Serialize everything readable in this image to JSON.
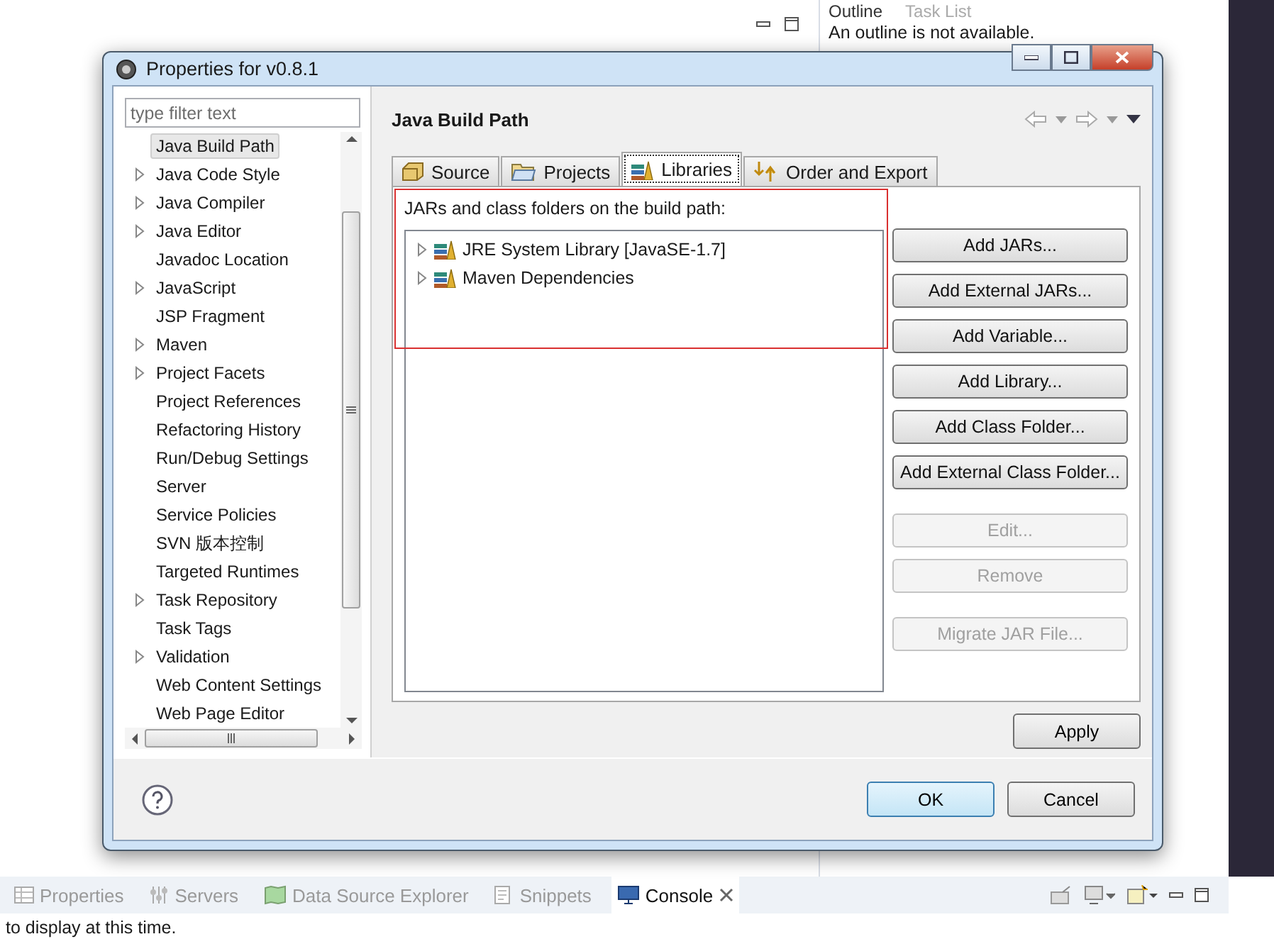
{
  "ide": {
    "top_tabs": [
      {
        "label": "Outline",
        "selected": true
      },
      {
        "label": "Task List",
        "selected": false
      }
    ],
    "outline_message": "An outline is not available.",
    "bottom_tabs": [
      {
        "label": "Properties",
        "selected": false
      },
      {
        "label": "Servers",
        "selected": false
      },
      {
        "label": "Data Source Explorer",
        "selected": false
      },
      {
        "label": "Snippets",
        "selected": false
      },
      {
        "label": "Console",
        "selected": true
      }
    ],
    "console_message": "to display at this time."
  },
  "dialog": {
    "title": "Properties for v0.8.1",
    "filter": {
      "placeholder": "type filter text"
    },
    "tree": [
      {
        "label": "Java Build Path",
        "expandable": false,
        "selected": true
      },
      {
        "label": "Java Code Style",
        "expandable": true,
        "selected": false
      },
      {
        "label": "Java Compiler",
        "expandable": true,
        "selected": false
      },
      {
        "label": "Java Editor",
        "expandable": true,
        "selected": false
      },
      {
        "label": "Javadoc Location",
        "expandable": false,
        "selected": false
      },
      {
        "label": "JavaScript",
        "expandable": true,
        "selected": false
      },
      {
        "label": "JSP Fragment",
        "expandable": false,
        "selected": false
      },
      {
        "label": "Maven",
        "expandable": true,
        "selected": false
      },
      {
        "label": "Project Facets",
        "expandable": true,
        "selected": false
      },
      {
        "label": "Project References",
        "expandable": false,
        "selected": false
      },
      {
        "label": "Refactoring History",
        "expandable": false,
        "selected": false
      },
      {
        "label": "Run/Debug Settings",
        "expandable": false,
        "selected": false
      },
      {
        "label": "Server",
        "expandable": false,
        "selected": false
      },
      {
        "label": "Service Policies",
        "expandable": false,
        "selected": false
      },
      {
        "label": "SVN 版本控制",
        "expandable": false,
        "selected": false
      },
      {
        "label": "Targeted Runtimes",
        "expandable": false,
        "selected": false
      },
      {
        "label": "Task Repository",
        "expandable": true,
        "selected": false
      },
      {
        "label": "Task Tags",
        "expandable": false,
        "selected": false
      },
      {
        "label": "Validation",
        "expandable": true,
        "selected": false
      },
      {
        "label": "Web Content Settings",
        "expandable": false,
        "selected": false
      },
      {
        "label": "Web Page Editor",
        "expandable": false,
        "selected": false
      }
    ],
    "page_title": "Java Build Path",
    "tabs": [
      {
        "label": "Source",
        "selected": false
      },
      {
        "label": "Projects",
        "selected": false
      },
      {
        "label": "Libraries",
        "selected": true
      },
      {
        "label": "Order and Export",
        "selected": false
      }
    ],
    "list_label": "JARs and class folders on the build path:",
    "libraries": [
      {
        "label": "JRE System Library [JavaSE-1.7]",
        "expanded": false
      },
      {
        "label": "Maven Dependencies",
        "expanded": false
      }
    ],
    "side_buttons": [
      {
        "label": "Add JARs...",
        "disabled": false,
        "gap_before": false
      },
      {
        "label": "Add External JARs...",
        "disabled": false,
        "gap_before": false
      },
      {
        "label": "Add Variable...",
        "disabled": false,
        "gap_before": false
      },
      {
        "label": "Add Library...",
        "disabled": false,
        "gap_before": false
      },
      {
        "label": "Add Class Folder...",
        "disabled": false,
        "gap_before": false
      },
      {
        "label": "Add External Class Folder...",
        "disabled": false,
        "gap_before": false
      },
      {
        "label": "Edit...",
        "disabled": true,
        "gap_before": true
      },
      {
        "label": "Remove",
        "disabled": true,
        "gap_before": false
      },
      {
        "label": "Migrate JAR File...",
        "disabled": true,
        "gap_before": true
      }
    ],
    "apply": "Apply",
    "ok": "OK",
    "cancel": "Cancel"
  }
}
